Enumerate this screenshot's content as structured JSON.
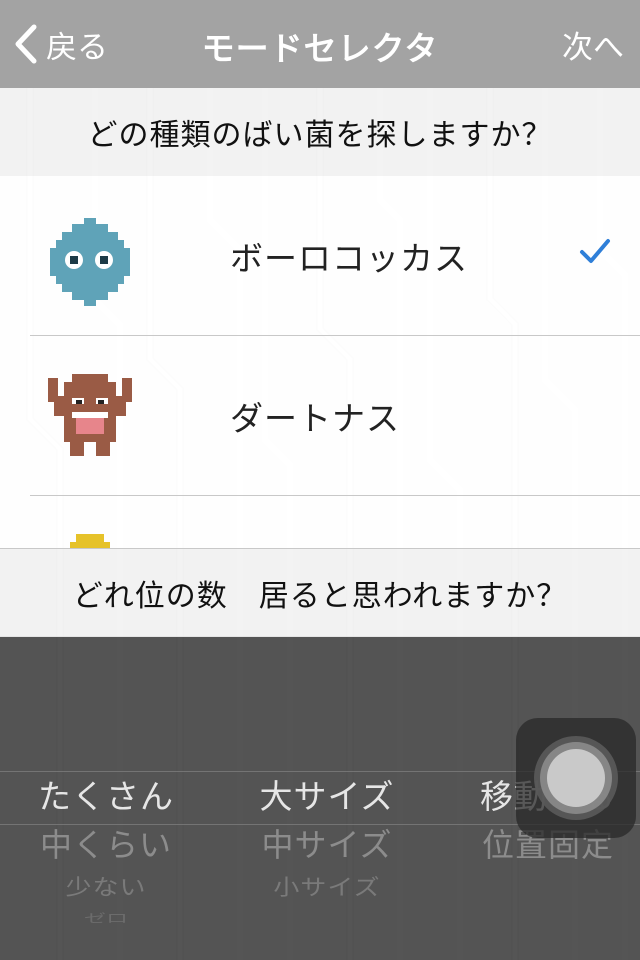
{
  "nav": {
    "back_label": "戻る",
    "title": "モードセレクタ",
    "next_label": "次へ"
  },
  "question1": "どの種類のばい菌を探しますか？",
  "germs": [
    {
      "label": "ボーロコッカス",
      "icon": "blue-germ-icon",
      "selected": true
    },
    {
      "label": "ダートナス",
      "icon": "brown-monster-icon",
      "selected": false
    },
    {
      "label": "",
      "icon": "yellow-germ-icon",
      "selected": false
    }
  ],
  "question2": "どれ位の数　居ると思われますか？",
  "pickers": {
    "quantity": {
      "options": [
        "たくさん",
        "中くらい",
        "少ない",
        "ゼロ"
      ],
      "selected": "たくさん"
    },
    "size": {
      "options": [
        "大サイズ",
        "中サイズ",
        "小サイズ"
      ],
      "selected": "大サイズ"
    },
    "motion": {
      "options": [
        "移動する",
        "位置固定"
      ],
      "selected": "移動する"
    }
  },
  "colors": {
    "navbar": "#a3a3a3",
    "check": "#2f7fd8",
    "germ_blue": "#5fa3b8",
    "monster_brown": "#9a5b45"
  }
}
